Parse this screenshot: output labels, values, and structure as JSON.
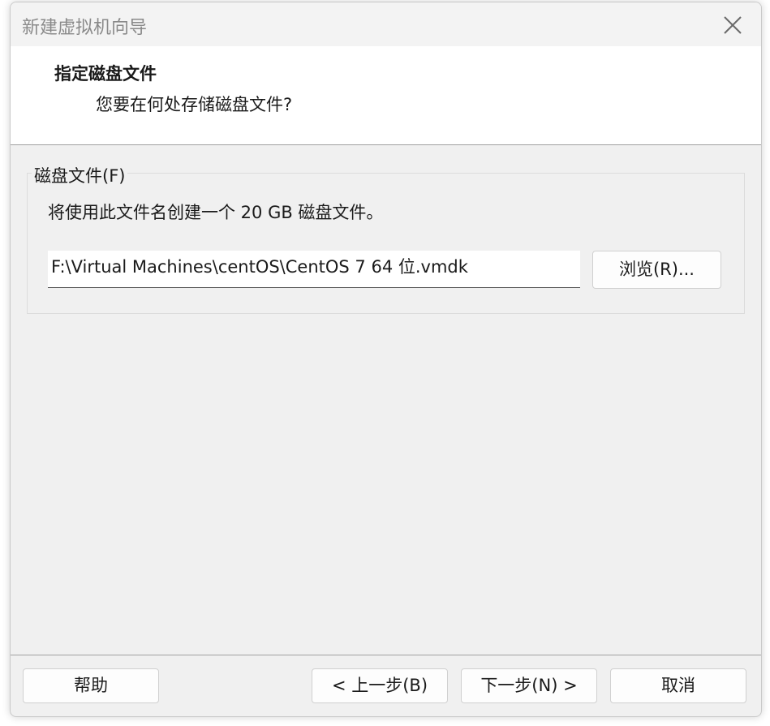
{
  "window": {
    "title": "新建虚拟机向导"
  },
  "header": {
    "title": "指定磁盘文件",
    "subtitle": "您要在何处存储磁盘文件?"
  },
  "disk_file_group": {
    "label": "磁盘文件(F)",
    "description": "将使用此文件名创建一个 20 GB 磁盘文件。",
    "path_value": "F:\\Virtual Machines\\centOS\\CentOS 7 64 位.vmdk",
    "browse_label": "浏览(R)..."
  },
  "footer": {
    "help_label": "帮助",
    "back_label": "< 上一步(B)",
    "next_label": "下一步(N) >",
    "cancel_label": "取消"
  },
  "icons": {
    "close": "close-icon"
  }
}
